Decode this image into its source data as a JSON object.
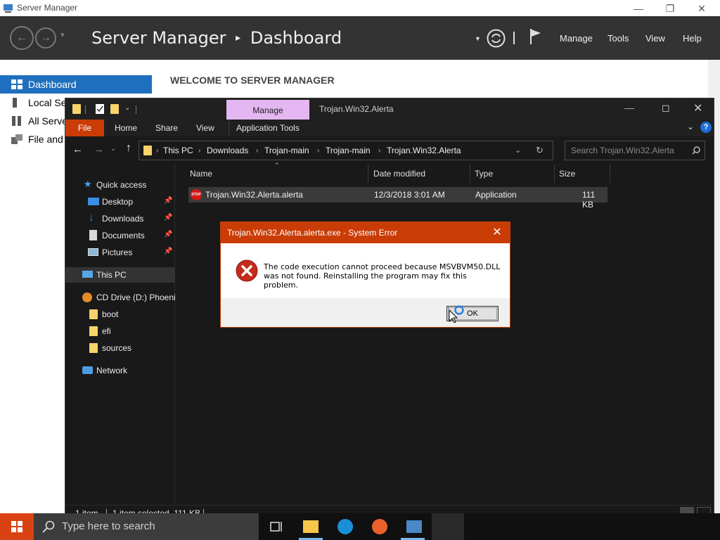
{
  "server_manager": {
    "window_title": "Server Manager",
    "breadcrumb": {
      "app": "Server Manager",
      "page": "Dashboard",
      "separator": "▸"
    },
    "menu": [
      "Manage",
      "Tools",
      "View",
      "Help"
    ],
    "nav": [
      {
        "label": "Dashboard"
      },
      {
        "label": "Local Se"
      },
      {
        "label": "All Serve"
      },
      {
        "label": "File and"
      }
    ],
    "welcome": "WELCOME TO SERVER MANAGER"
  },
  "explorer": {
    "context_tab": "Manage",
    "window_title": "Trojan.Win32.Alerta",
    "ribbon_tabs": [
      "File",
      "Home",
      "Share",
      "View",
      "Application Tools"
    ],
    "address_crumbs": [
      "This PC",
      "Downloads",
      "Trojan-main",
      "Trojan-main",
      "Trojan.Win32.Alerta"
    ],
    "search_placeholder": "Search Trojan.Win32.Alerta",
    "nav": {
      "quick_access": "Quick access",
      "desktop": "Desktop",
      "downloads": "Downloads",
      "documents": "Documents",
      "pictures": "Pictures",
      "this_pc": "This PC",
      "cd_drive": "CD Drive (D:) Phoenix",
      "boot": "boot",
      "efi": "efi",
      "sources": "sources",
      "network": "Network"
    },
    "columns": {
      "name": "Name",
      "date": "Date modified",
      "type": "Type",
      "size": "Size"
    },
    "file": {
      "icon_text": "STOP",
      "name": "Trojan.Win32.Alerta.alerta",
      "date": "12/3/2018 3:01 AM",
      "type": "Application",
      "size": "111 KB"
    },
    "status": {
      "items": "1 item",
      "selected": "1 item selected  111 KB"
    }
  },
  "dialog": {
    "title": "Trojan.Win32.Alerta.alerta.exe - System Error",
    "message_line1": "The code execution cannot proceed because MSVBVM50.DLL",
    "message_line2": "was not found. Reinstalling the program may fix this problem.",
    "ok_label": "OK"
  },
  "taskbar": {
    "search_placeholder": "Type here to search"
  }
}
